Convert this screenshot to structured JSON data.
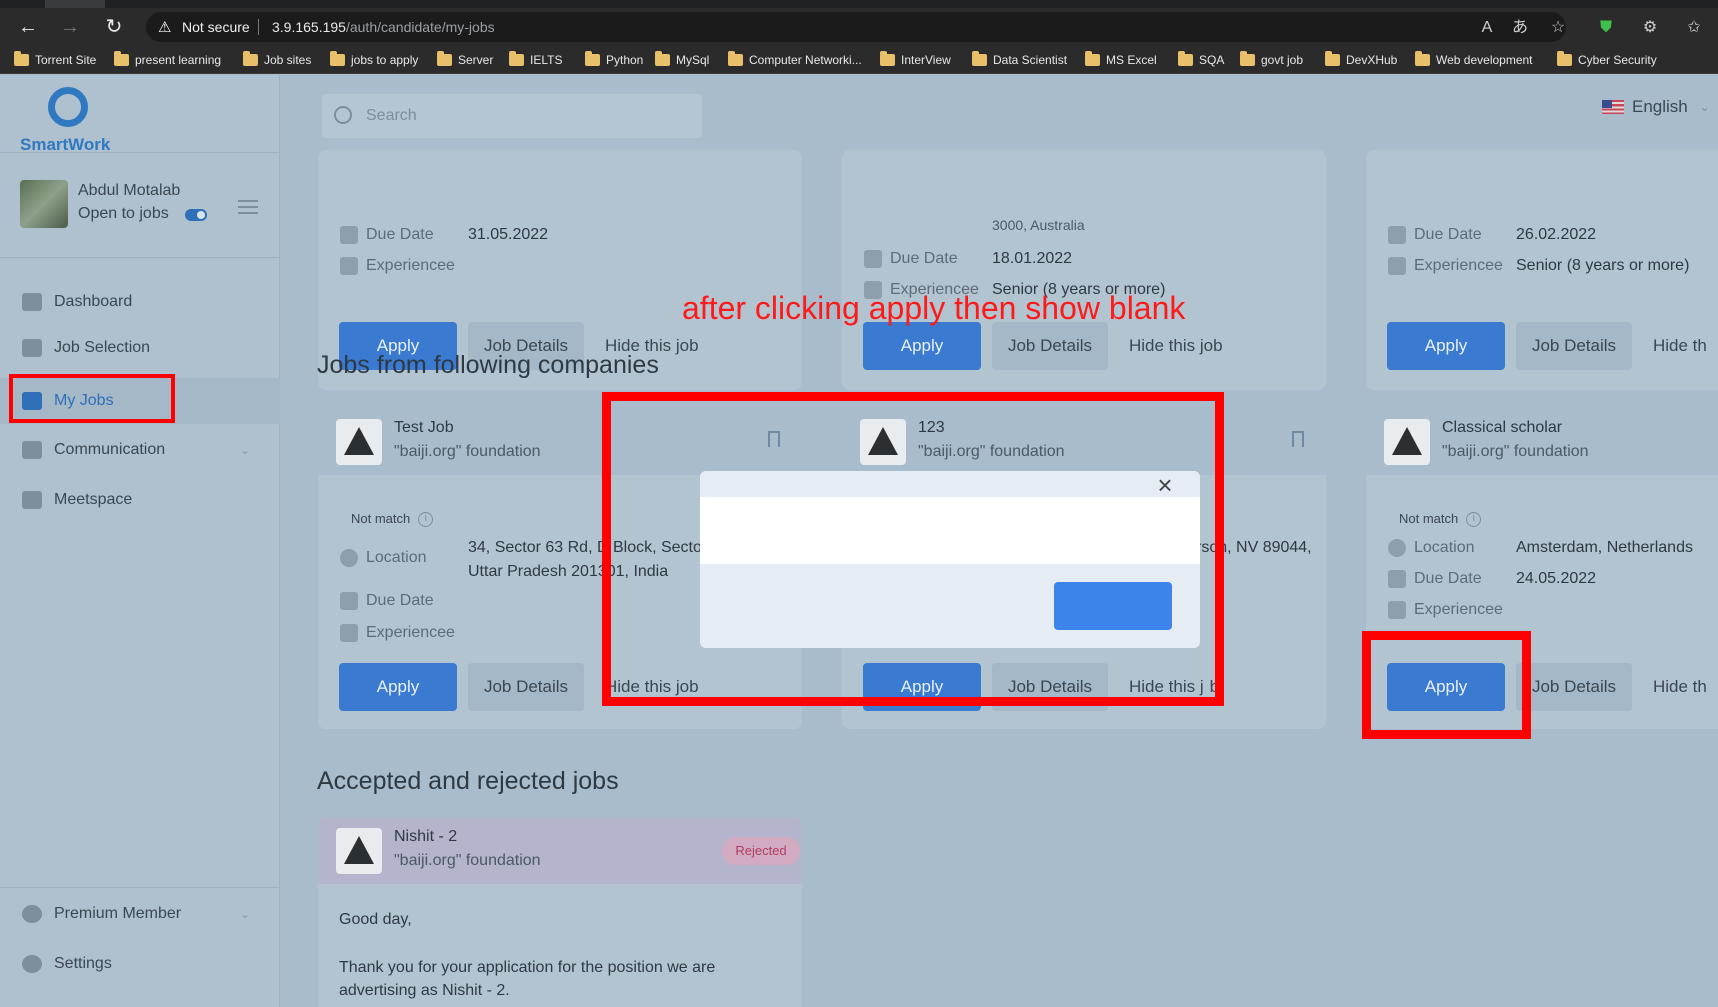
{
  "browser": {
    "warning_label": "Not secure",
    "url_host": "3.9.165.195",
    "url_path": "/auth/candidate/my-jobs",
    "bookmarks": [
      "Torrent Site",
      "present learning",
      "Job sites",
      "jobs to apply",
      "Server",
      "IELTS",
      "Python",
      "MySql",
      "Computer Networki...",
      "InterView",
      "Data Scientist",
      "MS Excel",
      "SQA",
      "govt job",
      "DevXHub",
      "Web development",
      "Cyber Security"
    ]
  },
  "sidebar": {
    "brand": "SmartWork",
    "user_name": "Abdul Motalab",
    "user_status": "Open to jobs",
    "nav": [
      "Dashboard",
      "Job Selection",
      "My Jobs",
      "Communication",
      "Meetspace"
    ],
    "bottom_nav": [
      "Premium Member",
      "Settings"
    ]
  },
  "header": {
    "search_placeholder": "Search",
    "language": "English"
  },
  "top_cards": [
    {
      "due_label": "Due Date",
      "due": "31.05.2022",
      "exp_label": "Experiencee",
      "exp": ""
    },
    {
      "partial_location": "3000, Australia",
      "due_label": "Due Date",
      "due": "18.01.2022",
      "exp_label": "Experiencee",
      "exp": "Senior (8 years or more)"
    },
    {
      "due_label": "Due Date",
      "due": "26.02.2022",
      "exp_label": "Experiencee",
      "exp": "Senior (8 years or more)"
    }
  ],
  "annotation": "after clicking apply  then show blank",
  "sections": {
    "following": "Jobs from following companies",
    "accepted": "Accepted and rejected jobs"
  },
  "job_cards": [
    {
      "title": "Test Job",
      "company": "\"baiji.org\" foundation",
      "match": "Not match",
      "location_label": "Location",
      "location": "34, Sector 63 Rd, D Block, Secto",
      "location2": "Uttar Pradesh 201301, India",
      "due_label": "Due Date",
      "exp_label": "Experiencee"
    },
    {
      "title": "123",
      "company": "\"baiji.org\" foundation",
      "location_tail": "rson, NV 89044,"
    },
    {
      "title": "Classical scholar",
      "company": "\"baiji.org\" foundation",
      "match": "Not match",
      "location_label": "Location",
      "location": "Amsterdam, Netherlands",
      "due_label": "Due Date",
      "due": "24.05.2022",
      "exp_label": "Experiencee"
    }
  ],
  "buttons": {
    "apply": "Apply",
    "details": "Job Details",
    "hide": "Hide this job",
    "hide_cut": "Hide th",
    "hide_cut2": "Hide this j",
    "hide_cut2b": "b"
  },
  "rejected_card": {
    "title": "Nishit - 2",
    "company": "\"baiji.org\" foundation",
    "badge": "Rejected",
    "greeting": "Good day,",
    "line1": "Thank you for your application for the position we are",
    "line2": "advertising as Nishit - 2."
  },
  "colors": {
    "annotation": "#ff0000",
    "accent": "#3a7ad1"
  }
}
